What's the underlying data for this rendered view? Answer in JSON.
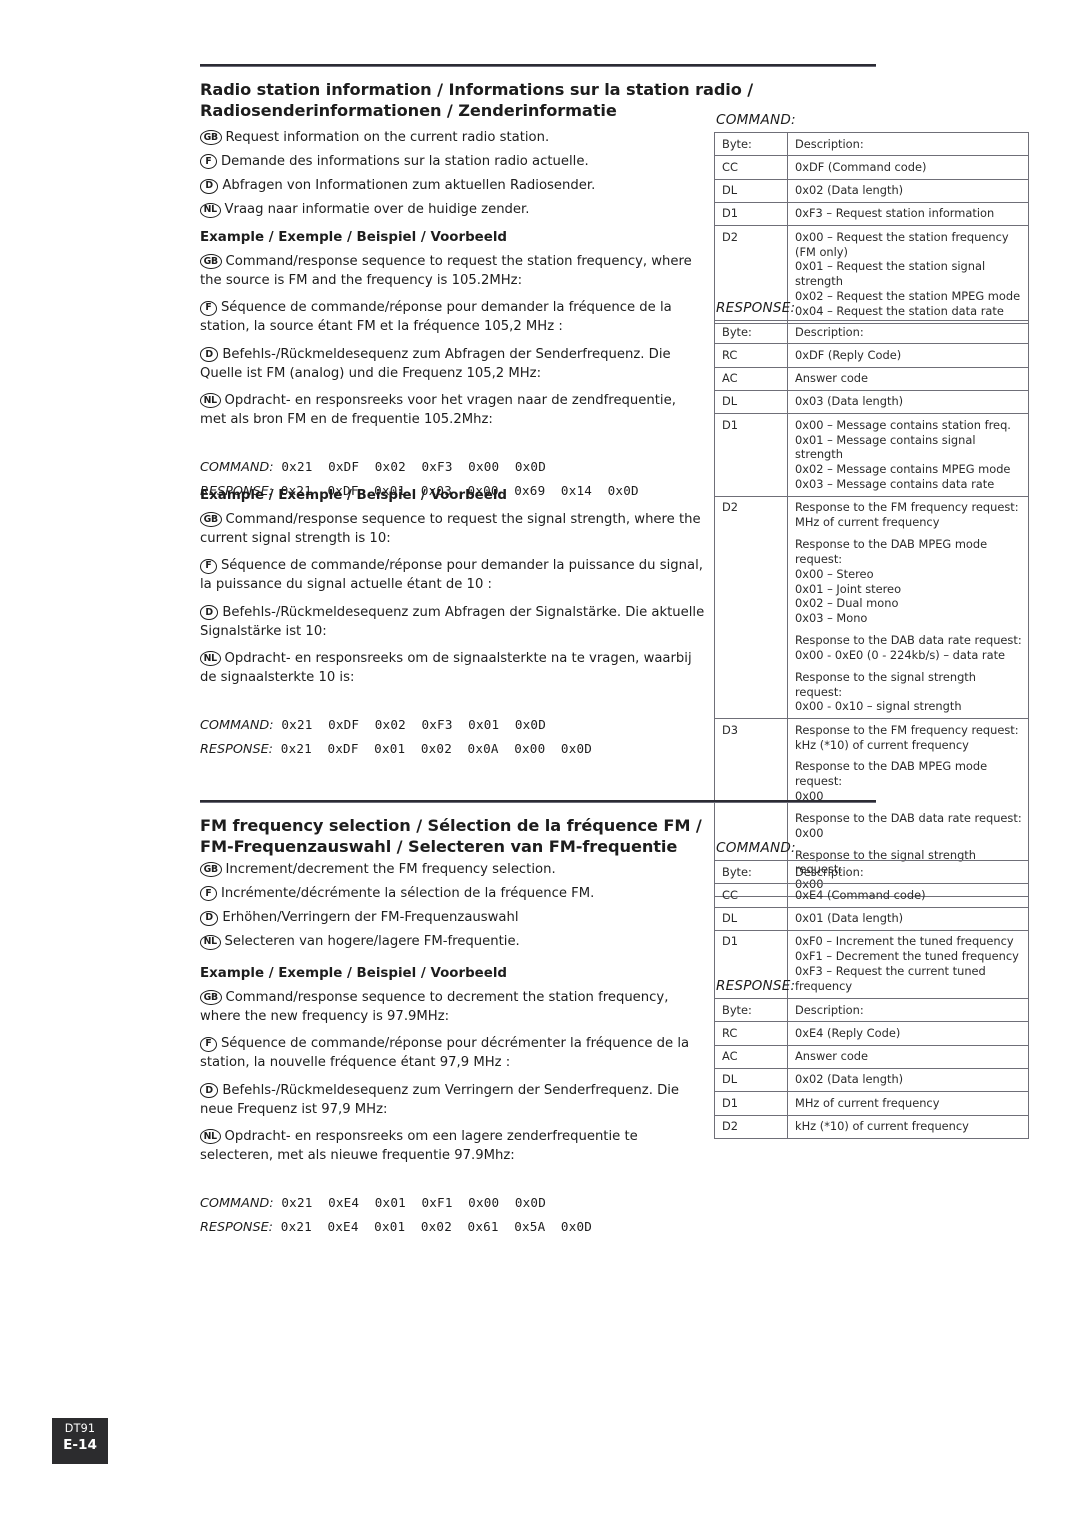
{
  "page": {
    "footer": {
      "model": "DT91",
      "page_number": "E-14"
    }
  },
  "sections": [
    {
      "title_line1": "Radio station information / Informations sur la station radio /",
      "title_line2": "Radiosenderinformationen / Zenderinformatie",
      "intro": [
        {
          "flag": "GB",
          "text": "Request information on the current radio station."
        },
        {
          "flag": "F",
          "text": "Demande des informations sur la station radio actuelle."
        },
        {
          "flag": "D",
          "text": "Abfragen von Informationen zum aktuellen Radiosender."
        },
        {
          "flag": "NL",
          "text": "Vraag naar informatie over de huidige zender."
        }
      ],
      "examples": [
        {
          "heading": "Example / Exemple / Beispiel / Voorbeeld",
          "lines": [
            {
              "flag": "GB",
              "text": "Command/response sequence to request the station frequency, where the source is FM and the frequency is 105.2MHz:"
            },
            {
              "flag": "F",
              "text": "Séquence de commande/réponse pour demander la fréquence de la station, la source étant FM et la fréquence 105,2 MHz :"
            },
            {
              "flag": "D",
              "text": "Befehls-/Rückmeldesequenz zum Abfragen der Senderfrequenz. Die Quelle ist FM (analog) und die Frequenz 105,2 MHz:"
            },
            {
              "flag": "NL",
              "text": "Opdracht- en responsreeks voor het vragen naar de zendfrequentie, met als bron FM en de frequentie 105.2Mhz:"
            }
          ],
          "command_label": "COMMAND:",
          "command_bytes": "0x21  0xDF  0x02  0xF3  0x00  0x0D",
          "response_label": "RESPONSE:",
          "response_bytes": "0x21  0xDF  0x01  0x03  0x00  0x69  0x14  0x0D"
        },
        {
          "heading": "Example / Exemple / Beispiel / Voorbeeld",
          "lines": [
            {
              "flag": "GB",
              "text": "Command/response sequence to request the signal strength, where the current signal strength is 10:"
            },
            {
              "flag": "F",
              "text": "Séquence de commande/réponse pour demander la puissance du signal, la puissance du signal actuelle étant de 10 :"
            },
            {
              "flag": "D",
              "text": "Befehls-/Rückmeldesequenz zum Abfragen der Signalstärke. Die aktuelle Signalstärke ist 10:"
            },
            {
              "flag": "NL",
              "text": "Opdracht- en responsreeks om de signaalsterkte na te vragen, waarbij de signaalsterkte 10 is:"
            }
          ],
          "command_label": "COMMAND:",
          "command_bytes": "0x21  0xDF  0x02  0xF3  0x01  0x0D",
          "response_label": "RESPONSE:",
          "response_bytes": "0x21  0xDF  0x01  0x02  0x0A  0x00  0x0D"
        }
      ],
      "tables": [
        {
          "caption": "COMMAND:",
          "rows": [
            {
              "byte": "Byte:",
              "desc": [
                "Description:"
              ]
            },
            {
              "byte": "CC",
              "desc": [
                "0xDF (Command code)"
              ]
            },
            {
              "byte": "DL",
              "desc": [
                "0x02 (Data length)"
              ]
            },
            {
              "byte": "D1",
              "desc": [
                "0xF3 – Request station information"
              ]
            },
            {
              "byte": "D2",
              "desc": [
                "0x00 – Request the station frequency (FM only)",
                "0x01 – Request the station signal strength",
                "0x02 – Request the station MPEG mode",
                "0x04 – Request the station data rate"
              ],
              "tight": true
            }
          ]
        },
        {
          "caption": "RESPONSE:",
          "rows": [
            {
              "byte": "Byte:",
              "desc": [
                "Description:"
              ]
            },
            {
              "byte": "RC",
              "desc": [
                "0xDF (Reply Code)"
              ]
            },
            {
              "byte": "AC",
              "desc": [
                "Answer code"
              ]
            },
            {
              "byte": "DL",
              "desc": [
                "0x03 (Data length)"
              ]
            },
            {
              "byte": "D1",
              "desc": [
                "0x00 – Message contains station freq.",
                "0x01 – Message contains signal strength",
                "0x02 – Message contains MPEG mode",
                "0x03 – Message contains data rate"
              ],
              "tight": true
            },
            {
              "byte": "D2",
              "desc": [
                "Response to the FM frequency request: MHz of current frequency",
                "Response to the DAB MPEG mode request:\n0x00 – Stereo\n0x01 – Joint stereo\n0x02 – Dual mono\n0x03 – Mono",
                "Response to the DAB data rate request:\n0x00 - 0xE0 (0 - 224kb/s) – data rate",
                "Response to the signal strength request:\n0x00 - 0x10 – signal strength"
              ]
            },
            {
              "byte": "D3",
              "desc": [
                "Response to the FM frequency request: kHz (*10) of current frequency",
                "Response to the DAB MPEG mode request:\n0x00",
                "Response to the DAB data rate request:\n0x00",
                "Response to the signal strength request:\n0x00"
              ]
            }
          ]
        }
      ]
    },
    {
      "title_line1": "FM frequency selection / Sélection de la fréquence FM /",
      "title_line2": "FM-Frequenzauswahl / Selecteren van FM-frequentie",
      "intro": [
        {
          "flag": "GB",
          "text": "Increment/decrement the FM frequency selection."
        },
        {
          "flag": "F",
          "text": "Incrémente/décrémente la sélection de la fréquence FM."
        },
        {
          "flag": "D",
          "text": "Erhöhen/Verringern der FM-Frequenzauswahl"
        },
        {
          "flag": "NL",
          "text": "Selecteren van hogere/lagere FM-frequentie."
        }
      ],
      "examples": [
        {
          "heading": "Example / Exemple / Beispiel / Voorbeeld",
          "lines": [
            {
              "flag": "GB",
              "text": "Command/response sequence to decrement the station frequency, where the new frequency is 97.9MHz:"
            },
            {
              "flag": "F",
              "text": "Séquence de commande/réponse pour décrémenter la fréquence de la station, la nouvelle fréquence étant 97,9 MHz :"
            },
            {
              "flag": "D",
              "text": "Befehls-/Rückmeldesequenz zum Verringern der Senderfrequenz. Die neue Frequenz ist 97,9 MHz:"
            },
            {
              "flag": "NL",
              "text": "Opdracht- en responsreeks om een lagere zenderfrequentie te selecteren, met als nieuwe frequentie 97.9Mhz:"
            }
          ],
          "command_label": "COMMAND:",
          "command_bytes": "0x21  0xE4  0x01  0xF1  0x00  0x0D",
          "response_label": "RESPONSE:",
          "response_bytes": "0x21  0xE4  0x01  0x02  0x61  0x5A  0x0D"
        }
      ],
      "tables": [
        {
          "caption": "COMMAND:",
          "rows": [
            {
              "byte": "Byte:",
              "desc": [
                "Description:"
              ]
            },
            {
              "byte": "CC",
              "desc": [
                "0xE4 (Command code)"
              ]
            },
            {
              "byte": "DL",
              "desc": [
                "0x01 (Data length)"
              ]
            },
            {
              "byte": "D1",
              "desc": [
                "0xF0 – Increment the tuned frequency",
                "0xF1 – Decrement the tuned frequency",
                "0xF3 – Request the current tuned frequency"
              ],
              "tight": true
            }
          ]
        },
        {
          "caption": "RESPONSE:",
          "rows": [
            {
              "byte": "Byte:",
              "desc": [
                "Description:"
              ]
            },
            {
              "byte": "RC",
              "desc": [
                "0xE4 (Reply Code)"
              ]
            },
            {
              "byte": "AC",
              "desc": [
                "Answer code"
              ]
            },
            {
              "byte": "DL",
              "desc": [
                "0x02 (Data length)"
              ]
            },
            {
              "byte": "D1",
              "desc": [
                "MHz of current frequency"
              ]
            },
            {
              "byte": "D2",
              "desc": [
                "kHz (*10) of current frequency"
              ]
            }
          ]
        }
      ]
    }
  ]
}
